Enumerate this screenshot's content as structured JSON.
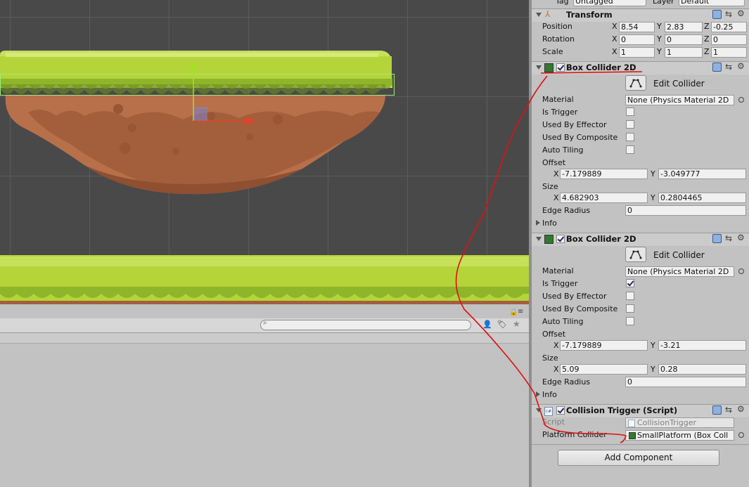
{
  "inspector": {
    "top_row": {
      "tag_label": "Tag",
      "tag_value": "Untagged",
      "layer_label": "Layer",
      "layer_value": "Default"
    },
    "transform": {
      "title": "Transform",
      "position": {
        "label": "Position",
        "x": "8.54",
        "y": "2.83",
        "z": "-0.25"
      },
      "rotation": {
        "label": "Rotation",
        "x": "0",
        "y": "0",
        "z": "0"
      },
      "scale": {
        "label": "Scale",
        "x": "1",
        "y": "1",
        "z": "1"
      },
      "axis_x": "X",
      "axis_y": "Y",
      "axis_z": "Z"
    },
    "box_collider_1": {
      "title": "Box Collider 2D",
      "edit_label": "Edit Collider",
      "material_label": "Material",
      "material_value": "None (Physics Material 2D",
      "is_trigger_label": "Is Trigger",
      "is_trigger": false,
      "used_by_effector_label": "Used By Effector",
      "used_by_composite_label": "Used By Composite",
      "auto_tiling_label": "Auto Tiling",
      "offset_label": "Offset",
      "offset_x": "-7.179889",
      "offset_y": "-3.049777",
      "size_label": "Size",
      "size_x": "4.682903",
      "size_y": "0.2804465",
      "edge_radius_label": "Edge Radius",
      "edge_radius": "0",
      "info_label": "Info"
    },
    "box_collider_2": {
      "title": "Box Collider 2D",
      "edit_label": "Edit Collider",
      "material_label": "Material",
      "material_value": "None (Physics Material 2D",
      "is_trigger_label": "Is Trigger",
      "is_trigger": true,
      "used_by_effector_label": "Used By Effector",
      "used_by_composite_label": "Used By Composite",
      "auto_tiling_label": "Auto Tiling",
      "offset_label": "Offset",
      "offset_x": "-7.179889",
      "offset_y": "-3.21",
      "size_label": "Size",
      "size_x": "5.09",
      "size_y": "0.28",
      "edge_radius_label": "Edge Radius",
      "edge_radius": "0",
      "info_label": "Info"
    },
    "collision_trigger": {
      "title": "Collision Trigger (Script)",
      "script_label": "Script",
      "script_value": "CollisionTrigger",
      "platform_collider_label": "Platform Collider",
      "platform_collider_value": "SmallPlatform (Box Coll"
    },
    "add_component_label": "Add Component"
  },
  "colors": {
    "annotation": "#e01010",
    "grass": "#b5d43a",
    "dirt": "#b8704a",
    "scene_bg": "#494949",
    "gizmo_y": "#a4e024",
    "gizmo_x": "#e0432a"
  }
}
